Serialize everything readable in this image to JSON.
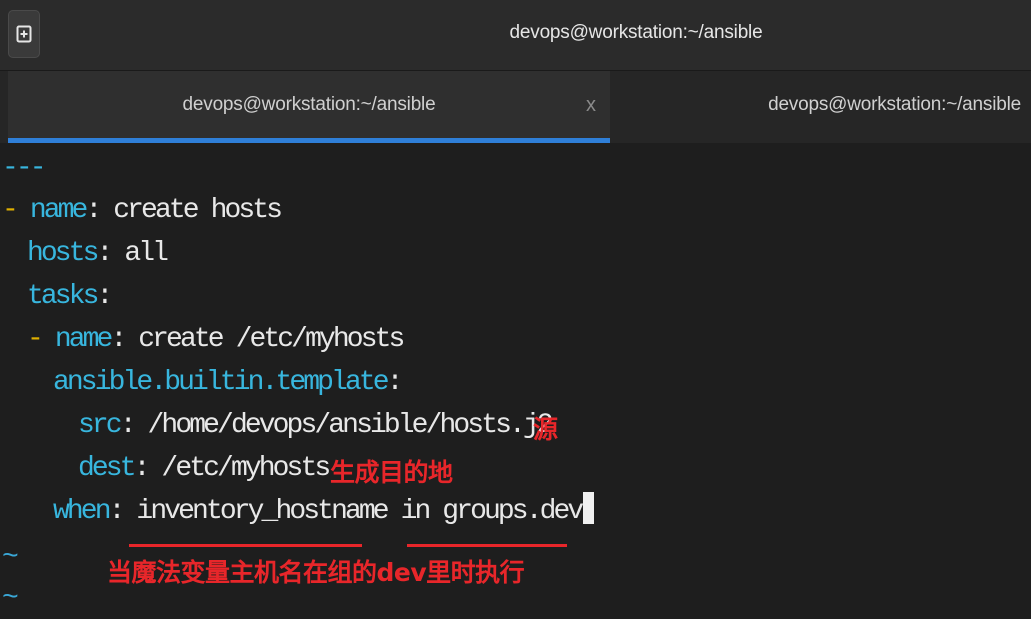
{
  "window": {
    "title": "devops@workstation:~/ansible",
    "new_tab_icon": "new-tab-icon"
  },
  "tabs": [
    {
      "label": "devops@workstation:~/ansible",
      "close": "x",
      "active": true
    },
    {
      "label": "devops@workstation:~/ansible",
      "active": false
    }
  ],
  "editor": {
    "doc_start": "---",
    "play_dash": "-",
    "play_name_key": "name",
    "play_name_value": " create hosts",
    "hosts_key": "hosts",
    "hosts_value": " all",
    "tasks_key": "tasks",
    "task_dash": "-",
    "task_name_key": "name",
    "task_name_value": " create /etc/myhosts",
    "module_key": "ansible.builtin.template",
    "src_key": "src",
    "src_value": " /home/devops/ansible/hosts.j2",
    "dest_key": "dest",
    "dest_value": " /etc/myhosts",
    "when_key": "when",
    "when_value": " inventory_hostname in groups.dev",
    "colon": ":",
    "tilde": "~"
  },
  "annotations": {
    "src_note": "源",
    "dest_note": "生成目的地",
    "when_note": "当魔法变量主机名在组的dev里时执行",
    "color": "#e8262a"
  },
  "colors": {
    "key": "#38b6de",
    "dash": "#e0b000",
    "text": "#e8e8e8",
    "accent_tab": "#2f7fd8"
  }
}
